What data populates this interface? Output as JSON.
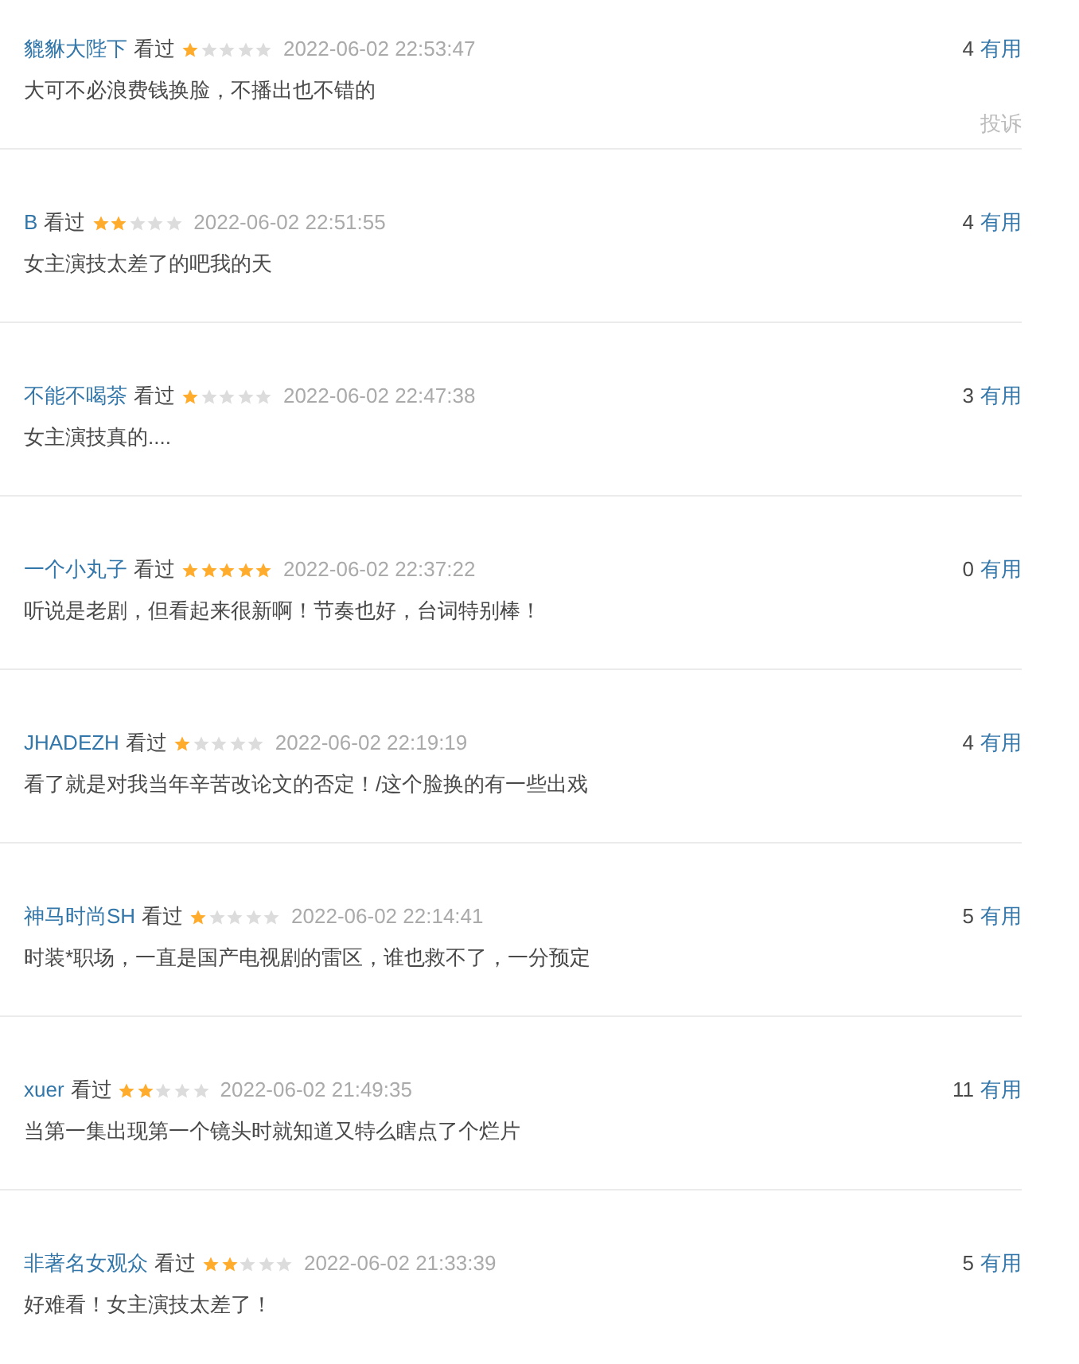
{
  "comments": [
    {
      "user": "貔貅大陛下",
      "status": "看过",
      "stars": 1,
      "time": "2022-06-02 22:53:47",
      "text": "大可不必浪费钱换脸，不播出也不错的",
      "votes": "4",
      "vote_label": "有用",
      "report": "投诉"
    },
    {
      "user": "B",
      "status": "看过",
      "stars": 2,
      "time": "2022-06-02 22:51:55",
      "text": "女主演技太差了的吧我的天",
      "votes": "4",
      "vote_label": "有用"
    },
    {
      "user": "不能不喝茶",
      "status": "看过",
      "stars": 1,
      "time": "2022-06-02 22:47:38",
      "text": "女主演技真的....",
      "votes": "3",
      "vote_label": "有用"
    },
    {
      "user": "一个小丸子",
      "status": "看过",
      "stars": 5,
      "time": "2022-06-02 22:37:22",
      "text": "听说是老剧，但看起来很新啊！节奏也好，台词特别棒！",
      "votes": "0",
      "vote_label": "有用"
    },
    {
      "user": "JHADEZH",
      "status": "看过",
      "stars": 1,
      "time": "2022-06-02 22:19:19",
      "text": "看了就是对我当年辛苦改论文的否定！/这个脸换的有一些出戏",
      "votes": "4",
      "vote_label": "有用"
    },
    {
      "user": "神马时尚SH",
      "status": "看过",
      "stars": 1,
      "time": "2022-06-02 22:14:41",
      "text": "时装*职场，一直是国产电视剧的雷区，谁也救不了，一分预定",
      "votes": "5",
      "vote_label": "有用"
    },
    {
      "user": "xuer",
      "status": "看过",
      "stars": 2,
      "time": "2022-06-02 21:49:35",
      "text": "当第一集出现第一个镜头时就知道又特么瞎点了个烂片",
      "votes": "11",
      "vote_label": "有用"
    },
    {
      "user": "非著名女观众",
      "status": "看过",
      "stars": 2,
      "time": "2022-06-02 21:33:39",
      "text": "好难看！女主演技太差了！",
      "votes": "5",
      "vote_label": "有用"
    }
  ]
}
